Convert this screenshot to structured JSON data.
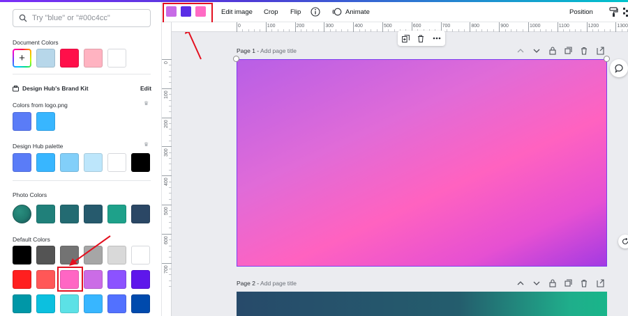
{
  "search": {
    "placeholder": "Try \"blue\" or \"#00c4cc\""
  },
  "sections": {
    "document_colors": {
      "title": "Document Colors",
      "colors": [
        "#b7d7ea",
        "#ff0f4a",
        "#ffb3c1",
        "#ffffff"
      ]
    },
    "brand_kit": {
      "title": "Design Hub's Brand Kit",
      "edit_label": "Edit"
    },
    "logo_colors": {
      "title": "Colors from logo.png",
      "colors": [
        "#5a7cf7",
        "#38b6ff"
      ]
    },
    "palette": {
      "title": "Design Hub palette",
      "colors": [
        "#5a7cf7",
        "#38b6ff",
        "#82cff9",
        "#bde6fb",
        "#ffffff",
        "#000000"
      ]
    },
    "photo_colors": {
      "title": "Photo Colors",
      "circle_color": "#1f7a6e",
      "colors": [
        "#20807a",
        "#236b72",
        "#265a6d",
        "#1ea18a",
        "#2b4765"
      ]
    },
    "default_colors": {
      "title": "Default Colors",
      "rows": [
        [
          "#000000",
          "#545454",
          "#737373",
          "#a6a6a6",
          "#d9d9d9",
          "#ffffff"
        ],
        [
          "#ff1f1f",
          "#ff5757",
          "#ff66c4",
          "#cb6ce6",
          "#8c52ff",
          "#5e17eb"
        ],
        [
          "#0097a7",
          "#0cc0df",
          "#5ce1e6",
          "#38b6ff",
          "#5271ff",
          "#004aad"
        ]
      ]
    }
  },
  "toolbar": {
    "swatches": [
      "#c76be6",
      "#5a2ee6",
      "#ff6bc4"
    ],
    "edit_image": "Edit image",
    "crop": "Crop",
    "flip": "Flip",
    "animate": "Animate",
    "position": "Position"
  },
  "ruler": {
    "top": [
      "0",
      "100",
      "200",
      "300",
      "400",
      "500",
      "600",
      "700",
      "800",
      "900",
      "1000",
      "1100",
      "1200",
      "1300"
    ],
    "left": [
      "0",
      "100",
      "200",
      "300",
      "400",
      "500",
      "600",
      "700"
    ]
  },
  "pages": [
    {
      "label": "Page 1 -",
      "title_placeholder": "Add page title"
    },
    {
      "label": "Page 2 -",
      "title_placeholder": "Add page title"
    }
  ],
  "icons": {
    "search": "search-icon",
    "brand": "brand-kit-icon",
    "crown": "crown-icon",
    "info": "info-icon",
    "animate": "animate-icon",
    "paint_roller": "paint-roller-icon",
    "chevron_up": "chevron-up-icon",
    "chevron_down": "chevron-down-icon",
    "lock": "lock-icon",
    "duplicate": "duplicate-icon",
    "trash": "trash-icon",
    "add_page": "add-page-icon",
    "more": "more-icon",
    "comment": "comment-icon",
    "rotate": "rotate-icon"
  },
  "accent": "#7d3cf0",
  "annotation_color": "#e3101f"
}
